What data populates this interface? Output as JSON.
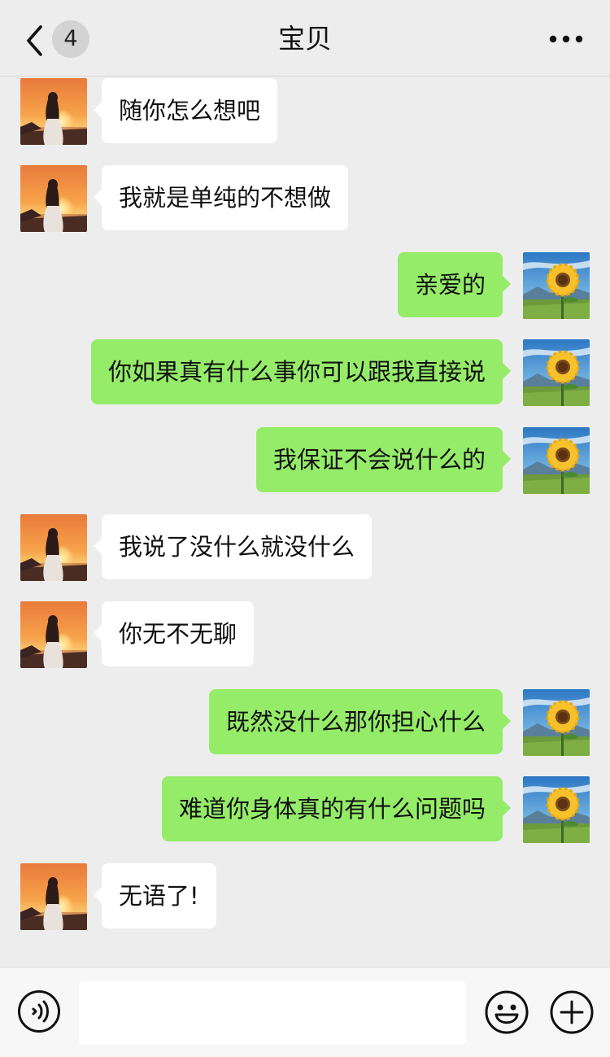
{
  "header": {
    "back_icon": "chevron-left-icon",
    "unread_count": "4",
    "title": "宝贝",
    "more_icon": "more-dots-icon"
  },
  "messages": [
    {
      "side": "left",
      "text": "随你怎么想吧"
    },
    {
      "side": "left",
      "text": "我就是单纯的不想做"
    },
    {
      "side": "right",
      "text": "亲爱的"
    },
    {
      "side": "right",
      "text": "你如果真有什么事你可以跟我直接说"
    },
    {
      "side": "right",
      "text": "我保证不会说什么的"
    },
    {
      "side": "left",
      "text": "我说了没什么就没什么"
    },
    {
      "side": "left",
      "text": "你无不无聊"
    },
    {
      "side": "right",
      "text": "既然没什么那你担心什么"
    },
    {
      "side": "right",
      "text": "难道你身体真的有什么问题吗"
    },
    {
      "side": "left",
      "text": "无语了!"
    }
  ],
  "colors": {
    "background": "#ededed",
    "bubble_sent": "#95ec69",
    "bubble_received": "#ffffff"
  },
  "input_bar": {
    "voice_icon": "voice-icon",
    "input_value": "",
    "emoji_icon": "emoji-icon",
    "plus_icon": "plus-icon"
  }
}
